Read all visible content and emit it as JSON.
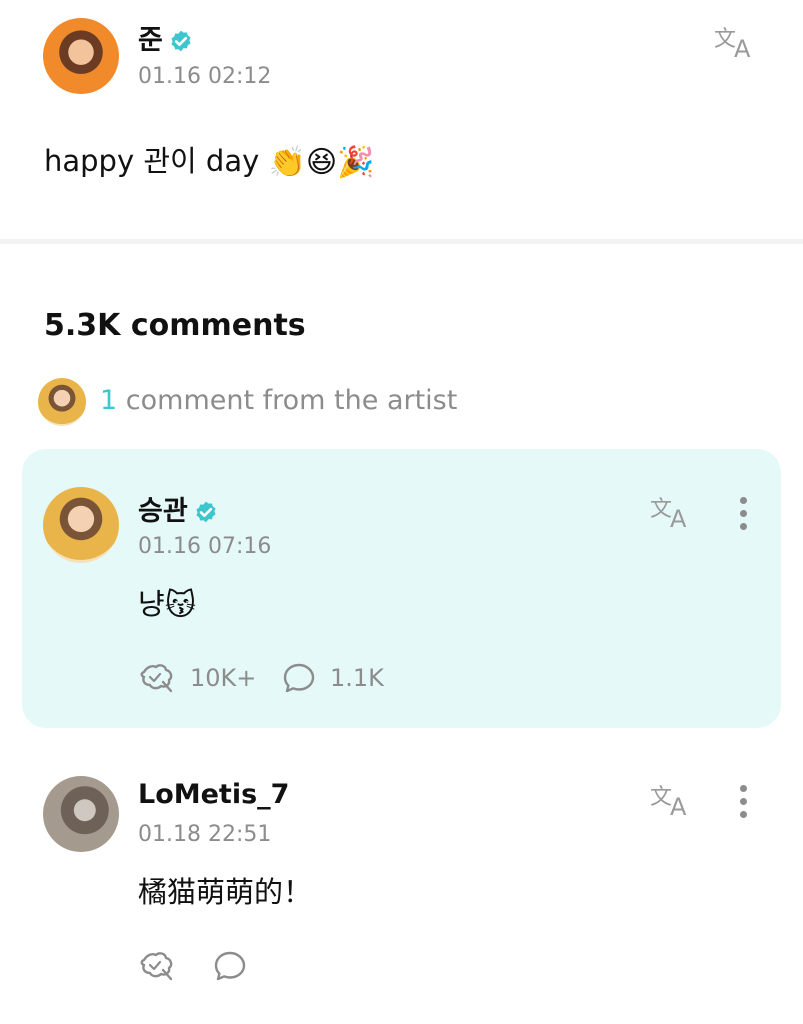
{
  "post": {
    "author": "준",
    "timestamp": "01.16 02:12",
    "text": "happy 관이 day",
    "emojis": [
      "👏",
      "😆",
      "🎉"
    ],
    "verified": true
  },
  "comments_section": {
    "count_label": "5.3K comments",
    "artist_count": "1",
    "artist_label": "comment from the artist"
  },
  "artist_comment": {
    "author": "승관",
    "timestamp": "01.16 07:16",
    "text": "냥",
    "emoji": "😽",
    "likes": "10K+",
    "replies": "1.1K",
    "verified": true
  },
  "fan_comment": {
    "author": "LoMetis_7",
    "timestamp": "01.18 22:51",
    "text": "橘猫萌萌的！"
  },
  "colors": {
    "accent": "#3ec6cf",
    "card_bg": "#e5f9f8",
    "muted_text": "#8c8c8c",
    "verified_badge": "#3ec6cf"
  },
  "icons": [
    "translate-icon",
    "verified-badge-icon",
    "more-options-icon",
    "like-icon",
    "comment-icon"
  ]
}
